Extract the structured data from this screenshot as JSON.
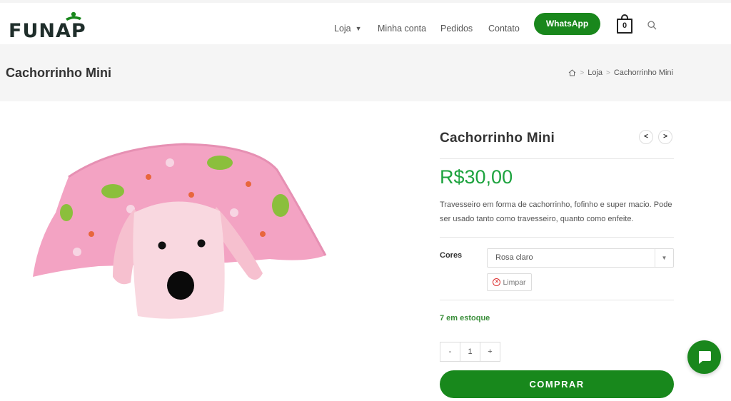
{
  "brand": {
    "logo_text": "FUNAP",
    "accent": "#19871c",
    "price_color": "#1ea33f"
  },
  "nav": {
    "loja": "Loja",
    "minha_conta": "Minha conta",
    "pedidos": "Pedidos",
    "contato": "Contato",
    "whatsapp": "WhatsApp",
    "cart_count": "0"
  },
  "page": {
    "title": "Cachorrinho Mini"
  },
  "breadcrumb": {
    "home_icon": "home-icon",
    "loja": "Loja",
    "current": "Cachorrinho Mini"
  },
  "product": {
    "title": "Cachorrinho Mini",
    "price": "R$30,00",
    "description": "Travesseiro em forma de cachorrinho, fofinho e super macio. Pode ser usado tanto como travesseiro, quanto como enfeite.",
    "variation_label": "Cores",
    "variation_selected": "Rosa claro",
    "clear_label": "Limpar",
    "stock": "7 em estoque",
    "qty_minus": "-",
    "qty_value": "1",
    "qty_plus": "+",
    "buy_label": "COMPRAR"
  }
}
